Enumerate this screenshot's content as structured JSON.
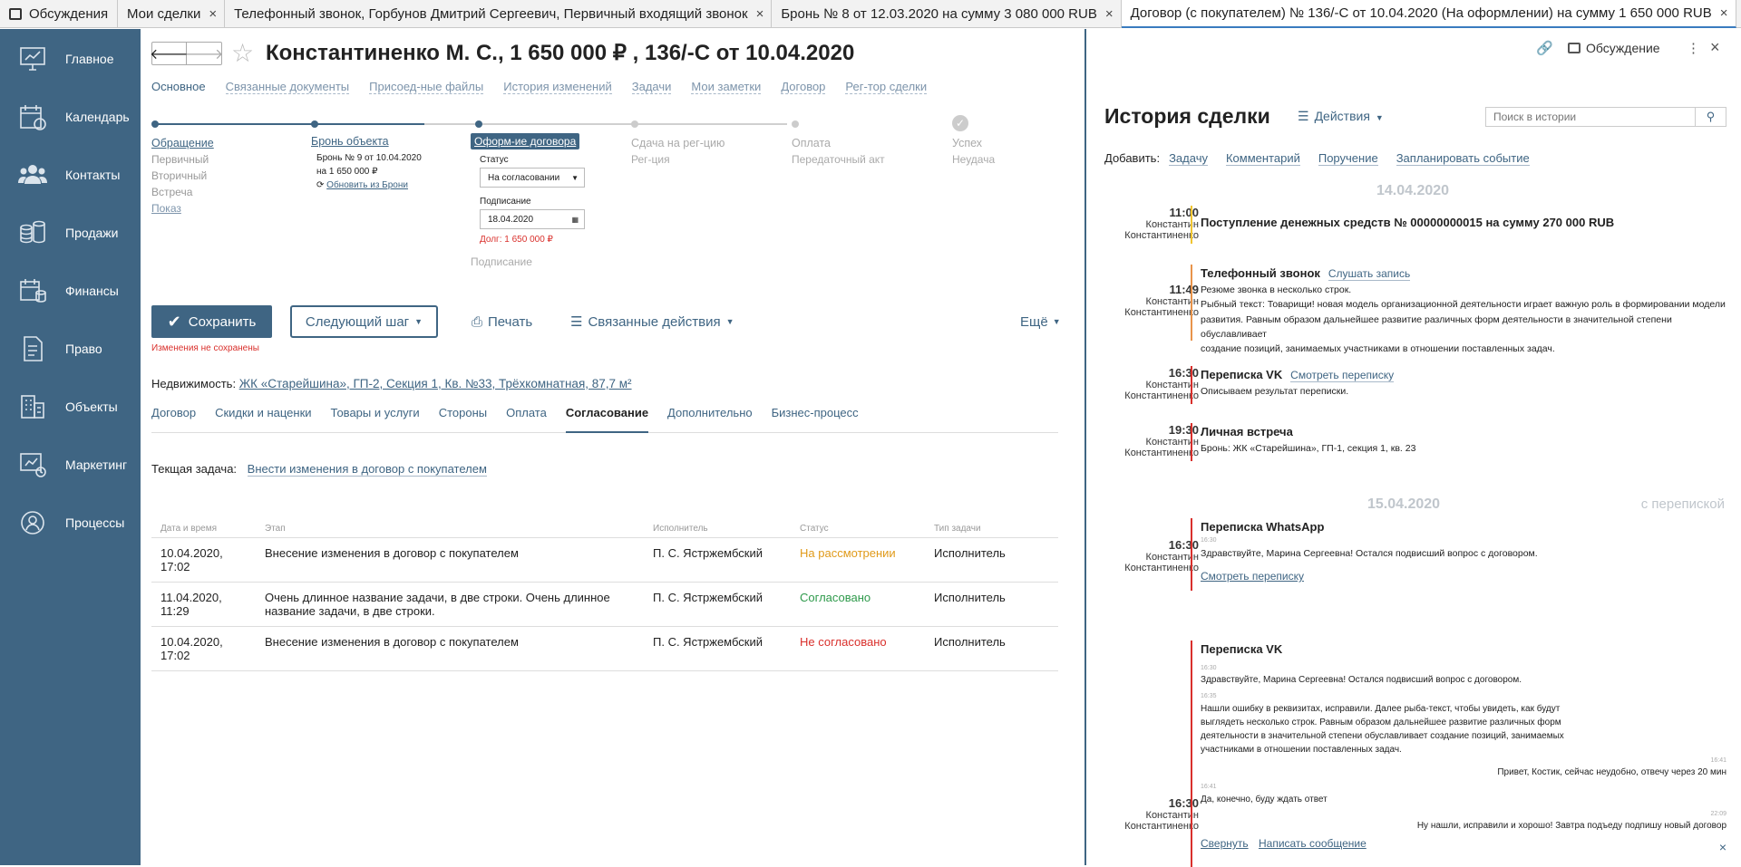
{
  "tabs": [
    {
      "label": "Обсуждения",
      "icon": "chat-icon"
    },
    {
      "label": "Мои сделки"
    },
    {
      "label": "Телефонный звонок, Горбунов Дмитрий Сергеевич, Первичный входящий звонок"
    },
    {
      "label": "Бронь № 8 от 12.03.2020 на сумму 3 080 000 RUB"
    },
    {
      "label": "Договор (с покупателем) № 136/-С от 10.04.2020 (На оформлении) на сумму 1 650 000 RUB",
      "active": true
    }
  ],
  "nav": [
    "Главное",
    "Календарь",
    "Контакты",
    "Продажи",
    "Финансы",
    "Право",
    "Объекты",
    "Маркетинг",
    "Процессы"
  ],
  "header": {
    "title": "Константиненко М. С., 1 650 000 ₽ , 136/-С от 10.04.2020",
    "discussion": "Обсуждение"
  },
  "subnav": [
    "Основное",
    "Связанные документы",
    "Присоед-ные файлы",
    "История изменений",
    "Задачи",
    "Мои заметки",
    "Договор",
    "Рег-тор сделки"
  ],
  "stages": {
    "s1": {
      "name": "Обращение",
      "items": [
        "Первичный",
        "Вторичный",
        "Встреча",
        "Показ"
      ]
    },
    "s2": {
      "name": "Бронь объекта",
      "l1": "Бронь № 9 от 10.04.2020",
      "l2": "на 1 650 000 ₽",
      "l3": "Обновить из Брони"
    },
    "s3": {
      "name": "Оформ-ие договора",
      "status_label": "Статус",
      "status_value": "На согласовании",
      "sign_label": "Подписание",
      "sign_value": "18.04.2020",
      "debt": "Долг: 1 650 000 ₽",
      "sub": "Подписание"
    },
    "s4": {
      "name": "Сдача на рег-цию",
      "l1": "Рег-ция"
    },
    "s5": {
      "name": "Оплата",
      "l1": "Передаточный акт"
    },
    "s6": {
      "name": "Успех",
      "l1": "Неудача"
    }
  },
  "actions": {
    "save": "Сохранить",
    "next": "Следующий шаг",
    "print": "Печать",
    "related": "Связанные действия",
    "more": "Ещё",
    "unsaved": "Изменения не сохранены"
  },
  "property": {
    "label": "Недвижимость:",
    "value": "ЖК «Старейшина», ГП-2, Секция 1, Кв. №33, Трёхкомнатная, 87,7 м²"
  },
  "inner_tabs": [
    "Договор",
    "Скидки и наценки",
    "Товары и услуги",
    "Стороны",
    "Оплата",
    "Согласование",
    "Дополнительно",
    "Бизнес-процесс"
  ],
  "current_task": {
    "label": "Текщая задача:",
    "value": "Внести изменения в договор с покупателем"
  },
  "table": {
    "headers": [
      "Дата и время",
      "Этап",
      "Исполнитель",
      "Статус",
      "Тип задачи"
    ],
    "rows": [
      {
        "date": "10.04.2020, 17:02",
        "stage": "Внесение изменения в договор с покупателем",
        "exec": "П. С. Ястржембский",
        "status": "На рассмотрении",
        "status_color": "#e09a1a",
        "type": "Исполнитель"
      },
      {
        "date": "11.04.2020, 11:29",
        "stage": "Очень длинное название задачи, в две строки. Очень длинное название задачи, в две строки.",
        "exec": "П. С. Ястржембский",
        "status": "Согласовано",
        "status_color": "#2e9a4b",
        "type": "Исполнитель"
      },
      {
        "date": "10.04.2020, 17:02",
        "stage": "Внесение изменения в договор с покупателем",
        "exec": "П. С. Ястржембский",
        "status": "Не согласовано",
        "status_color": "#d9302c",
        "type": "Исполнитель"
      }
    ]
  },
  "history": {
    "title": "История сделки",
    "actions": "Действия",
    "search_placeholder": "Поиск в истории",
    "add_label": "Добавить:",
    "add": [
      "Задачу",
      "Комментарий",
      "Поручение",
      "Запланировать событие"
    ],
    "date1": "14.04.2020",
    "date2": "15.04.2020",
    "filter": "с перепиской",
    "author1": "Константин",
    "author2": "Константиненко",
    "e1": {
      "time": "11:00",
      "title": "Поступление денежных средств № 00000000015 на сумму 270 000 RUB"
    },
    "e2": {
      "time": "11:49",
      "title": "Телефонный звонок",
      "link": "Слушать запись",
      "l1": "Резюме звонка в несколько строк.",
      "l2": "Рыбный текст: Товарищи! новая модель организационной деятельности играет важную роль в формировании модели",
      "l3": "развития. Равным образом дальнейшее развитие различных форм деятельности в значительной степени обуславливает",
      "l4": "создание позиций, занимаемых участниками в отношении поставленных задач."
    },
    "e3": {
      "time": "16:30",
      "title": "Переписка VK",
      "link": "Смотреть переписку",
      "l1": "Описываем результат переписки."
    },
    "e4": {
      "time": "19:30",
      "title": "Личная встреча",
      "l1": "Бронь: ЖК «Старейшина», ГП-1, секция 1, кв. 23"
    },
    "e5": {
      "time": "16:30",
      "title": "Переписка WhatsApp",
      "ts": "16:30",
      "l1": "Здравствуйте, Марина Сергеевна! Остался подвисший вопрос с договором.",
      "link": "Смотреть переписку"
    },
    "e6": {
      "time": "16:30",
      "title": "Переписка VK",
      "ts1": "16:30",
      "m1": "Здравствуйте, Марина Сергеевна! Остался подвисший вопрос с договором.",
      "ts2": "16:35",
      "m2a": "Нашли ошибку в реквизитах, исправили. Далее рыба-текст, чтобы увидеть, как будут",
      "m2b": "выглядеть несколько строк. Равным образом дальнейшее развитие различных форм",
      "m2c": "деятельности в значительной степени обуславливает создание позиций, занимаемых",
      "m2d": "участниками в отношении поставленных задач.",
      "ts3": "16:41",
      "m3": "Привет, Костик, сейчас неудобно, отвечу через 20 мин",
      "ts4": "16:41",
      "m4": "Да, конечно, буду ждать ответ",
      "ts5": "22:09",
      "m5": "Ну нашли, исправили и хорошо! Завтра подъеду подпишу новый договор",
      "collapse": "Свернуть",
      "write": "Написать сообщение"
    }
  }
}
